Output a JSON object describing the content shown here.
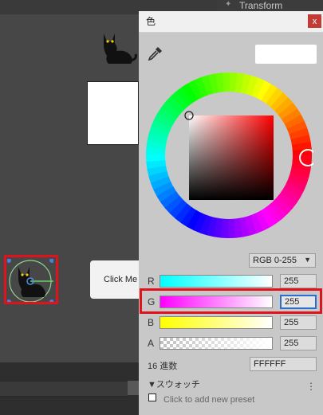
{
  "inspector": {
    "transform_label": "Transform"
  },
  "scene": {
    "button_label": "Click Me"
  },
  "picker": {
    "title": "色",
    "close_label": "x",
    "mode": "RGB 0-255",
    "channels": [
      {
        "label": "R",
        "value": "255"
      },
      {
        "label": "G",
        "value": "255"
      },
      {
        "label": "B",
        "value": "255"
      },
      {
        "label": "A",
        "value": "255"
      }
    ],
    "hex_label": "16 進数",
    "hex_value": "FFFFFF",
    "swatches_label": "▼スウォッチ",
    "swatch_menu": "⋮",
    "add_preset": "Click to add new preset",
    "colors": {
      "preview": "#ffffff",
      "highlight": "#e0131d",
      "focus": "#2a6fcf"
    }
  }
}
